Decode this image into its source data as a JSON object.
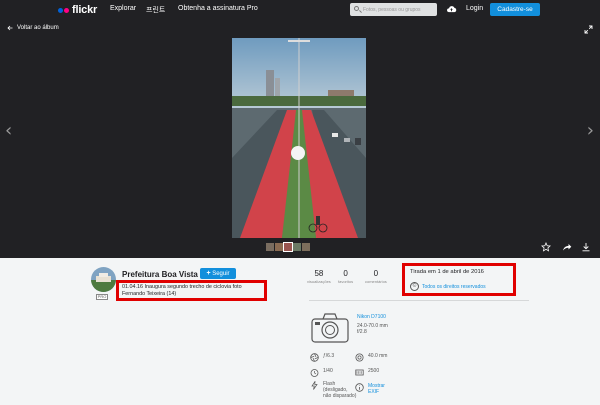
{
  "nav": {
    "logo": "flickr",
    "links": [
      "Explorar",
      "프린트",
      "Obtenha a assinatura Pro"
    ],
    "search_placeholder": "Fotos, pessoas ou grupos",
    "login": "Login",
    "signup": "Cadastre-se"
  },
  "viewer": {
    "back_label": "Voltar ao álbum",
    "thumbnail_count": 5
  },
  "owner": {
    "name": "Prefeitura Boa Vista",
    "follow_label": "Seguir",
    "follow_plus": "+",
    "badge": "PRO"
  },
  "photo": {
    "title_line1": "01.04.16 Inaugura segundo trecho de ciclovia foto",
    "title_line2": "Fernando Teixeira (14)"
  },
  "stats": [
    {
      "value": "58",
      "label": "visualizações"
    },
    {
      "value": "0",
      "label": "favoritos"
    },
    {
      "value": "0",
      "label": "comentários"
    }
  ],
  "meta": {
    "taken": "Tirada em 1 de abril de 2016",
    "cc_symbol": "©",
    "rights": "Todos os direitos reservados"
  },
  "camera": {
    "model": "Nikon D7100",
    "lens_range": "24.0-70.0 mm",
    "lens_aperture": "f/2.8"
  },
  "exif": {
    "aperture": "ƒ/6.3",
    "focal": "40.0 mm",
    "shutter": "1/40",
    "iso": "2500",
    "flash_line1": "Flash",
    "flash_line2": "(desligado,",
    "flash_line3": "não disparado)",
    "exif_link_line1": "Mostrar",
    "exif_link_line2": "EXIF"
  },
  "colors": {
    "nav_bg": "#212124",
    "accent": "#128fdc",
    "highlight": "#e00000",
    "info_bg": "#f3f5f6"
  }
}
